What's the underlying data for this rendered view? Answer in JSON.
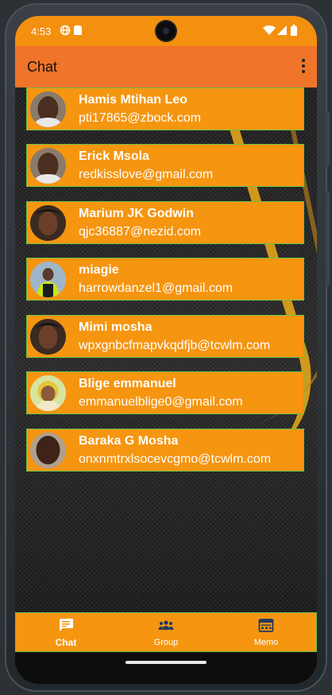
{
  "status_bar": {
    "time": "4:53"
  },
  "app_bar": {
    "title": "Chat"
  },
  "contacts": [
    {
      "name": "Hamis Mtihan Leo",
      "email": "pti17865@zbock.com"
    },
    {
      "name": "Erick Msola",
      "email": "redkisslove@gmail.com"
    },
    {
      "name": "Marium JK Godwin",
      "email": "qjc36887@nezid.com"
    },
    {
      "name": "miagie",
      "email": "harrowdanzel1@gmail.com"
    },
    {
      "name": "Mimi mosha",
      "email": "wpxgnbcfmapvkqdfjb@tcwlm.com"
    },
    {
      "name": "Blige emmanuel",
      "email": "emmanuelblige0@gmail.com"
    },
    {
      "name": "Baraka G Mosha",
      "email": "onxnmtrxlsocevcgmo@tcwlm.com"
    }
  ],
  "bottom_nav": {
    "items": [
      {
        "label": "Chat",
        "icon": "chat-icon",
        "active": true
      },
      {
        "label": "Group",
        "icon": "group-icon",
        "active": false
      },
      {
        "label": "Memo",
        "icon": "calendar-icon",
        "active": false
      }
    ]
  },
  "colors": {
    "status_bar": "#f4900f",
    "app_bar": "#f0742a",
    "card": "#f59510",
    "card_border": "#6cc04a"
  }
}
